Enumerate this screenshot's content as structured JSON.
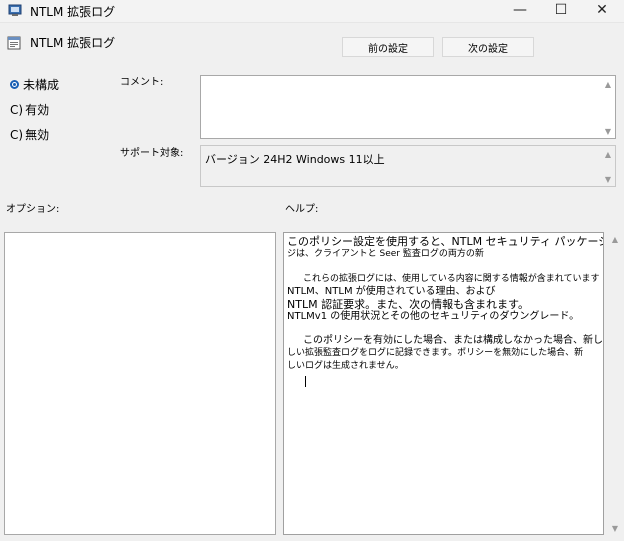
{
  "window": {
    "title": "NTLM 拡張ログ",
    "minimize_glyph": "—",
    "maximize_glyph": "☐",
    "close_glyph": "✕"
  },
  "policy": {
    "name": "NTLM 拡張ログ"
  },
  "nav": {
    "prev_label": "前の設定",
    "next_label": "次の設定"
  },
  "state": {
    "not_configured_label": "未構成",
    "enabled_label": "有効",
    "disabled_label": "無効",
    "paren_glyph": "C)",
    "selected": "not_configured"
  },
  "comment": {
    "label": "コメント:",
    "value": ""
  },
  "supported": {
    "label": "サポート対象:",
    "value": "バージョン 24H2 Windows 11以上"
  },
  "options": {
    "label": "オプション:"
  },
  "help": {
    "label": "ヘルプ:",
    "lines": [
      "このポリシー設定を使用すると、NTLM セキュリティ パッケージ",
      "ジは、クライアントと Seer 監査ログの両方の新",
      "",
      "これらの拡張ログには、使用している内容に関する情報が含まれています",
      "NTLM、NTLM が使用されている理由、および",
      "NTLM 認証要求。また、次の情報も含まれます。",
      "NTLMv1 の使用状況とその他のセキュリティのダウングレード。",
      "",
      "このポリシーを有効にした場合、または構成しなかった場合、新しい",
      "しい拡張監査ログをログに記録できます。ポリシーを無効にした場合、新",
      "しいログは生成されません。"
    ]
  },
  "scroll": {
    "up_glyph": "▲",
    "down_glyph": "▼"
  },
  "colors": {
    "accent": "#1a5fb4"
  }
}
